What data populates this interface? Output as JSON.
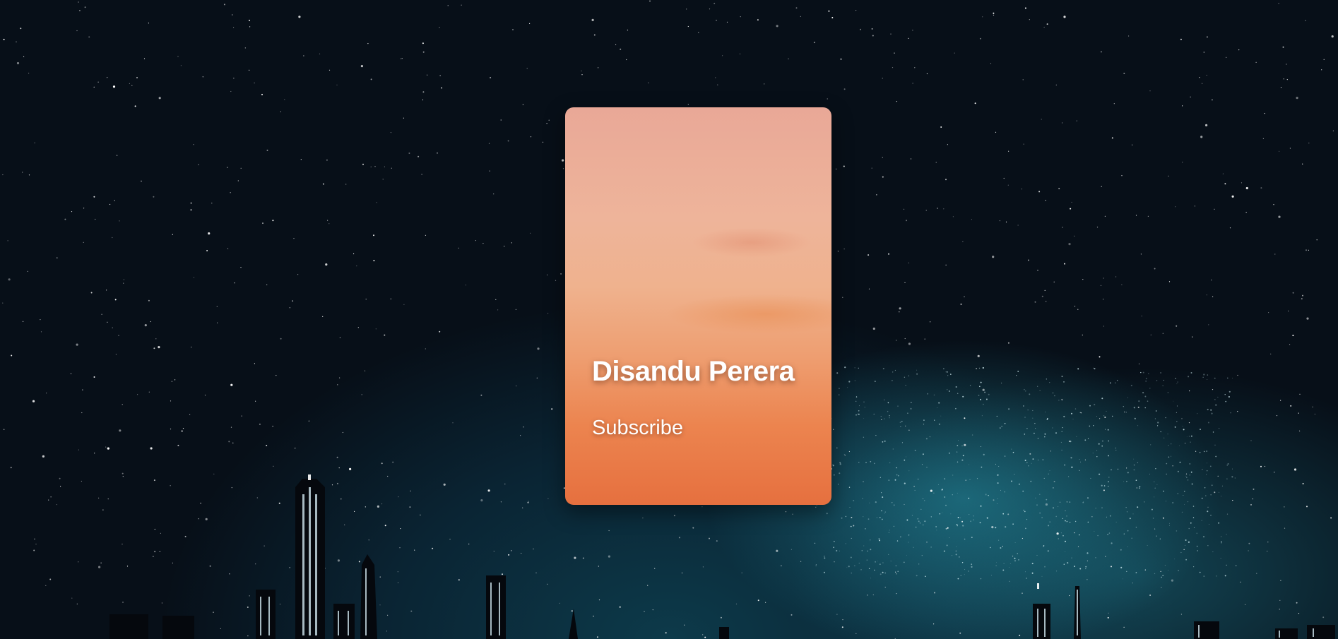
{
  "card": {
    "name": "Disandu Perera",
    "subscribe_label": "Subscribe"
  },
  "colors": {
    "card_top": "#e9a897",
    "card_bottom": "#e6703f",
    "sky_dark": "#070f18",
    "sky_glow": "#2896aa"
  }
}
